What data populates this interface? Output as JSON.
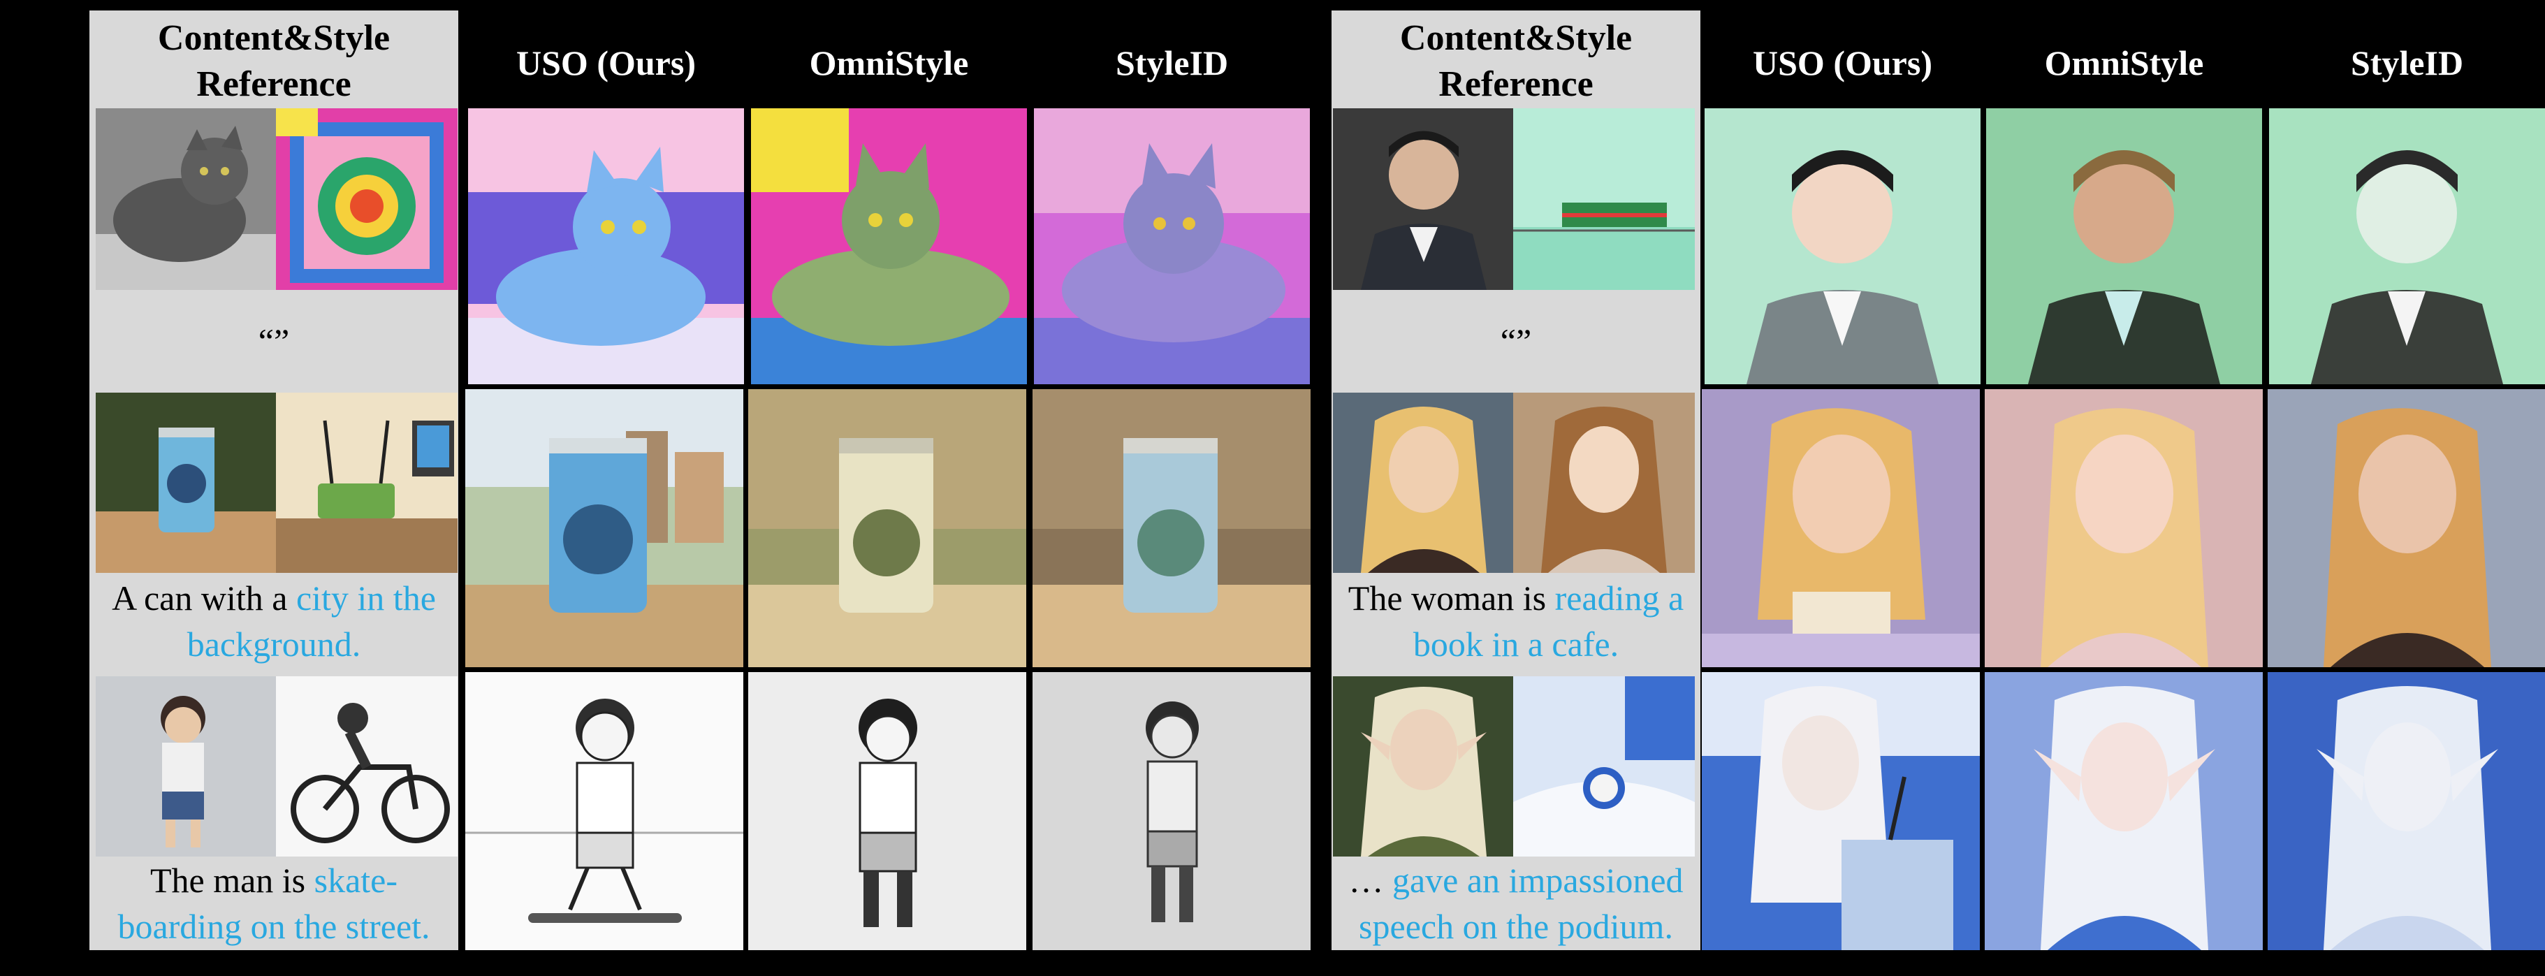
{
  "left_panel": {
    "header": {
      "ref_line1": "Content&Style",
      "ref_line2": "Reference",
      "methods": [
        "USO (Ours)",
        "OmniStyle",
        "StyleID"
      ]
    },
    "rows": [
      {
        "prompt_plain": "“”",
        "prompt_highlight": "",
        "content_ref": "gray-cat-photo",
        "style_ref": "colorful-washing-machine-art",
        "results": [
          "cartoon-blue-cat",
          "pink-green-cat",
          "purple-blue-cat"
        ]
      },
      {
        "prompt_plain": "A can with a ",
        "prompt_highlight": "city in the background.",
        "content_ref": "beer-can-photo",
        "style_ref": "router-desk-illustration",
        "results": [
          "can-city-scene",
          "can-sandy-beige",
          "can-sandy-warm"
        ]
      },
      {
        "prompt_plain": "The man is ",
        "prompt_highlight": "skate-boarding on the street.",
        "content_ref": "boy-figure-photo",
        "style_ref": "motorbike-sketch",
        "results": [
          "boy-skateboard-sketch",
          "boy-standing-sketch",
          "boy-standing-pencil"
        ]
      }
    ]
  },
  "right_panel": {
    "header": {
      "ref_line1": "Content&Style",
      "ref_line2": "Reference",
      "methods": [
        "USO (Ours)",
        "OmniStyle",
        "StyleID"
      ]
    },
    "rows": [
      {
        "prompt_plain": "“”",
        "prompt_highlight": "",
        "content_ref": "man-portrait-photo",
        "style_ref": "green-train-illustration",
        "results": [
          "man-flat-mint",
          "man-painted-green",
          "man-pale-green"
        ]
      },
      {
        "prompt_plain": "The woman is ",
        "prompt_highlight": "reading a book in a cafe.",
        "content_ref": "blonde-woman-photo",
        "style_ref": "girl-oil-painting",
        "results": [
          "woman-reading-painting",
          "woman-pink-painting",
          "woman-warm-painting"
        ]
      },
      {
        "prompt_plain": "… ",
        "prompt_highlight": "gave an impassioned speech on the podium.",
        "content_ref": "elf-woman-photo",
        "style_ref": "blue-clock-watercolor",
        "results": [
          "elf-podium-watercolor",
          "elf-blue-portrait",
          "elf-white-watercolor"
        ]
      }
    ]
  },
  "colors": {
    "highlight": "#29a8e0",
    "ref_bg": "#d9d9d9",
    "background": "#000000"
  }
}
